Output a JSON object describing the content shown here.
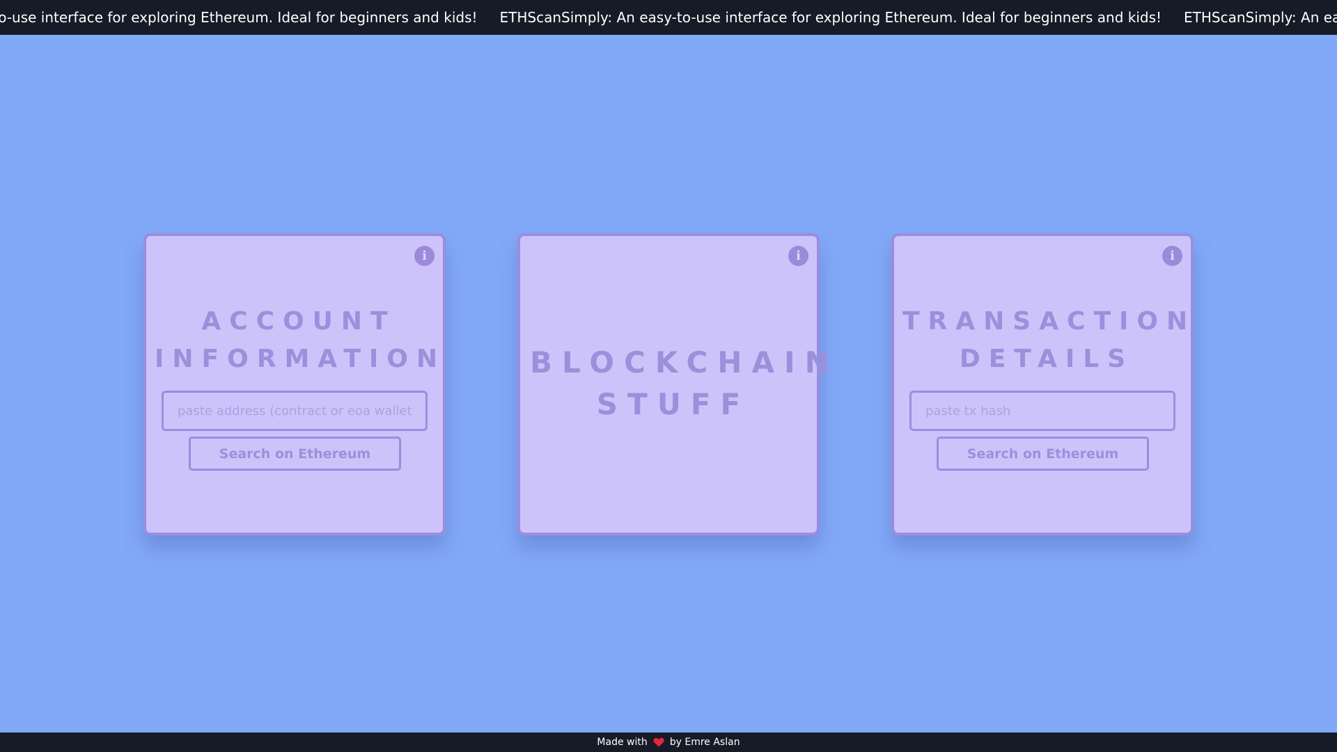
{
  "marquee": {
    "items": [
      "asy-to-use interface for exploring Ethereum. Ideal for beginners and kids!",
      "ETHScanSimply: An easy-to-use interface for exploring Ethereum. Ideal for beginners and kids!",
      "ETHScanSimply: An easy"
    ]
  },
  "cards": {
    "account": {
      "title_line1": "ACCOUNT",
      "title_line2": "INFORMATION",
      "input_placeholder": "paste address (contract or eoa wallet)",
      "input_value": "",
      "button_label": "Search on Ethereum",
      "info_icon": "info-icon"
    },
    "blockchain": {
      "title_line1": "BLOCKCHAIN",
      "title_line2": "STUFF",
      "info_icon": "info-icon"
    },
    "transaction": {
      "title_line1": "TRANSACTION",
      "title_line2": "DETAILS",
      "input_placeholder": "paste tx hash",
      "input_value": "",
      "button_label": "Search on Ethereum",
      "info_icon": "info-icon"
    }
  },
  "footer": {
    "prefix": "Made with",
    "suffix": "by Emre Aslan",
    "heart_icon": "heart-icon",
    "heart_color": "#e8263a"
  },
  "colors": {
    "background": "#82a9f7",
    "bar": "#161b27",
    "card": "#ccc3fa",
    "card_accent": "#9a8de0"
  }
}
